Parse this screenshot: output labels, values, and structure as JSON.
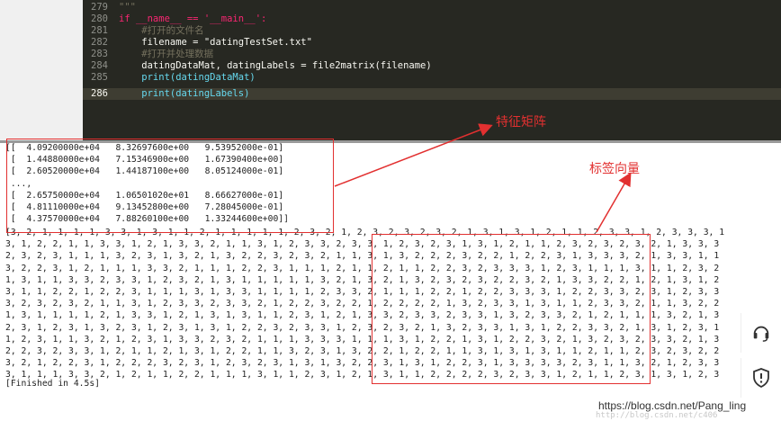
{
  "editor": {
    "lines": [
      {
        "num": "279",
        "code": "\"\"\""
      },
      {
        "num": "280",
        "code": "if __name__ == '__main__':"
      },
      {
        "num": "281",
        "code": "    #打开的文件名"
      },
      {
        "num": "282",
        "code": "    filename = \"datingTestSet.txt\""
      },
      {
        "num": "283",
        "code": "    #打开并处理数据"
      },
      {
        "num": "284",
        "code": "    datingDataMat, datingLabels = file2matrix(filename)"
      },
      {
        "num": "285",
        "code": "    print(datingDataMat)"
      },
      {
        "num": "286",
        "code": "    print(datingLabels)"
      }
    ]
  },
  "console": {
    "matrix_lines": [
      "[[  4.09200000e+04   8.32697600e+00   9.53952000e-01]",
      " [  1.44880000e+04   7.15346900e+00   1.67390400e+00]",
      " [  2.60520000e+04   1.44187100e+00   8.05124000e-01]",
      " ...,",
      " [  2.65750000e+04   1.06501020e+01   8.66627000e-01]",
      " [  4.81110000e+04   9.13452800e+00   7.28045000e-01]",
      " [  4.37570000e+04   7.88260100e+00   1.33244600e+00]]"
    ],
    "label_lines": [
      "[3, 2, 1, 1, 1, 1, 3, 3, 1, 3, 1, 1, 2, 1, 1, 1, 1, 1, 2, 3, 2, 1, 2, 3, 2, 3, 2, 3, 2, 1, 3, 1, 3, 1, 2, 1, 1, 2, 3, 3, 1, 2, 3, 3, 3, 1",
      "3, 1, 2, 2, 1, 1, 3, 3, 1, 2, 1, 3, 3, 2, 1, 1, 3, 1, 2, 3, 3, 2, 3, 3, 1, 2, 3, 2, 3, 1, 3, 1, 2, 1, 1, 2, 3, 2, 3, 2, 3, 2, 1, 3, 3, 3",
      "2, 3, 2, 3, 1, 1, 1, 3, 2, 3, 1, 3, 2, 1, 3, 2, 2, 3, 2, 3, 2, 1, 1, 3, 1, 3, 2, 2, 2, 3, 2, 2, 1, 2, 2, 3, 1, 3, 3, 3, 2, 1, 3, 3, 1, 1",
      "3, 2, 2, 3, 1, 2, 1, 1, 1, 3, 3, 2, 1, 1, 1, 2, 2, 3, 1, 1, 1, 2, 1, 1, 2, 1, 1, 2, 2, 3, 2, 3, 3, 3, 1, 2, 3, 1, 1, 1, 3, 1, 1, 2, 3, 2",
      "1, 3, 1, 1, 3, 3, 2, 3, 3, 1, 2, 3, 2, 1, 3, 1, 1, 1, 1, 1, 3, 2, 1, 3, 2, 1, 3, 2, 3, 2, 3, 2, 2, 3, 2, 1, 3, 3, 2, 2, 1, 2, 1, 3, 1, 2",
      "3, 1, 1, 2, 2, 1, 2, 2, 3, 1, 1, 1, 3, 1, 3, 3, 1, 1, 1, 1, 2, 3, 3, 2, 1, 1, 1, 2, 2, 1, 2, 2, 3, 3, 3, 1, 2, 2, 3, 3, 2, 3, 1, 2, 3, 3",
      "3, 2, 3, 2, 3, 2, 1, 1, 3, 1, 2, 3, 3, 2, 3, 3, 2, 1, 2, 2, 3, 2, 2, 1, 2, 2, 2, 2, 1, 3, 2, 3, 3, 1, 3, 1, 1, 2, 3, 3, 2, 1, 1, 3, 2, 2",
      "1, 3, 1, 1, 1, 1, 2, 1, 3, 3, 1, 2, 1, 3, 1, 3, 1, 1, 2, 3, 1, 2, 1, 3, 3, 2, 3, 3, 2, 3, 3, 1, 3, 2, 3, 3, 2, 1, 2, 1, 1, 1, 3, 2, 1, 3",
      "2, 3, 1, 2, 3, 1, 3, 2, 3, 1, 2, 3, 1, 3, 1, 2, 2, 3, 2, 3, 3, 1, 2, 3, 2, 3, 2, 1, 3, 2, 3, 3, 1, 3, 1, 2, 2, 3, 3, 2, 1, 3, 1, 2, 3, 1",
      "1, 2, 3, 1, 1, 3, 2, 1, 2, 3, 1, 3, 3, 2, 3, 2, 1, 1, 1, 3, 3, 3, 1, 1, 1, 3, 1, 2, 2, 1, 3, 1, 2, 2, 3, 2, 1, 3, 2, 3, 2, 3, 3, 2, 1, 3",
      "2, 2, 3, 2, 3, 3, 1, 2, 1, 1, 2, 1, 3, 1, 2, 2, 1, 1, 3, 2, 3, 1, 3, 2, 2, 1, 2, 2, 1, 1, 3, 1, 3, 1, 3, 1, 1, 2, 1, 1, 2, 3, 2, 3, 2, 2",
      "3, 2, 1, 2, 2, 3, 1, 2, 2, 2, 3, 2, 3, 1, 2, 3, 2, 3, 1, 3, 1, 3, 2, 2, 3, 1, 3, 1, 2, 2, 3, 1, 3, 3, 3, 3, 2, 3, 1, 1, 3, 2, 1, 2, 3, 3",
      "3, 1, 1, 1, 3, 3, 2, 1, 2, 1, 1, 2, 2, 1, 1, 1, 3, 1, 1, 2, 3, 1, 2, 1, 3, 1, 1, 2, 2, 2, 2, 3, 2, 3, 3, 1, 2, 1, 1, 2, 3, 1, 3, 1, 2, 3"
    ],
    "finished": "[Finished in 4.5s]"
  },
  "annotations": {
    "matrix_label": "特征矩阵",
    "labels_label": "标签向量",
    "color": "#e23030"
  },
  "sidebar_buttons": [
    {
      "icon": "headset-icon"
    },
    {
      "icon": "shield-icon"
    }
  ],
  "watermark": {
    "main": "https://blog.csdn.net/Pang_ling",
    "faint": "http://blog.csdn.net/c406"
  }
}
